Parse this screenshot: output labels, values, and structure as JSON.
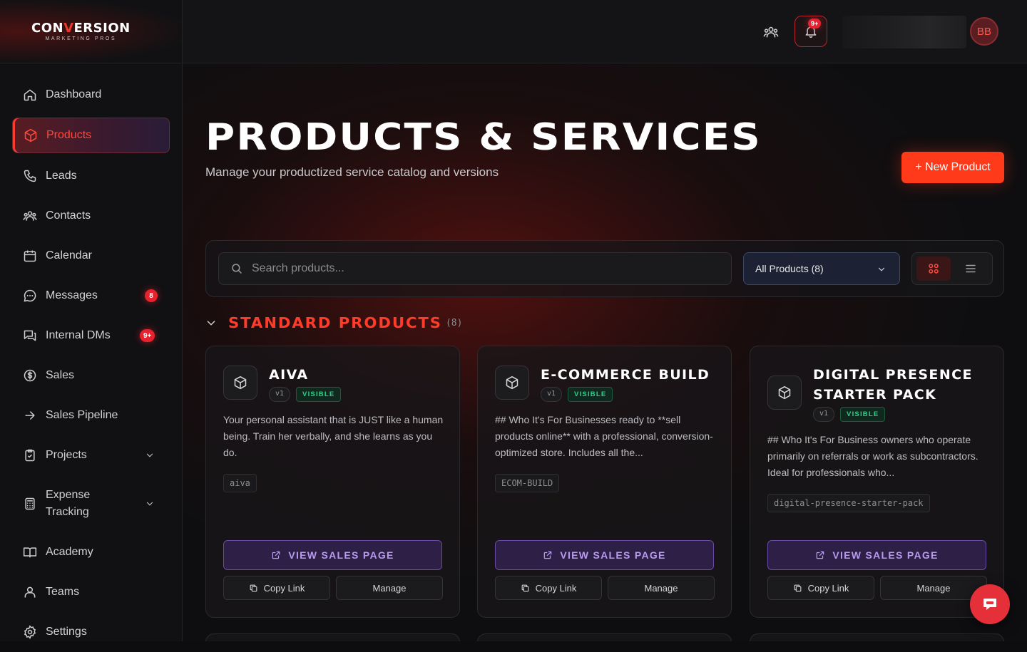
{
  "brand": {
    "logo_main_left": "CON",
    "logo_main_v": "V",
    "logo_main_right": "ERSION",
    "logo_sub": "MARKETING PROS"
  },
  "sidebar": {
    "items": [
      {
        "label": "Dashboard",
        "icon": "home-icon"
      },
      {
        "label": "Products",
        "icon": "package-icon",
        "active": true
      },
      {
        "label": "Leads",
        "icon": "phone-icon"
      },
      {
        "label": "Contacts",
        "icon": "users-icon"
      },
      {
        "label": "Calendar",
        "icon": "calendar-icon"
      },
      {
        "label": "Messages",
        "icon": "message-icon",
        "badge": "8"
      },
      {
        "label": "Internal DMs",
        "icon": "chat-bubbles-icon",
        "badge": "9+"
      },
      {
        "label": "Sales",
        "icon": "dollar-circle-icon"
      },
      {
        "label": "Sales Pipeline",
        "icon": "arrow-right-icon"
      },
      {
        "label": "Projects",
        "icon": "clipboard-icon",
        "expandable": true
      },
      {
        "label": "Expense Tracking",
        "icon": "calculator-icon",
        "expandable": true
      },
      {
        "label": "Academy",
        "icon": "book-icon"
      },
      {
        "label": "Teams",
        "icon": "team-icon"
      },
      {
        "label": "Settings",
        "icon": "gear-icon"
      }
    ]
  },
  "topbar": {
    "notification_badge": "9+",
    "avatar_initials": "BB"
  },
  "page": {
    "title": "PRODUCTS & SERVICES",
    "subtitle": "Manage your productized service catalog and versions",
    "new_button": "+ New Product"
  },
  "filters": {
    "search_placeholder": "Search products...",
    "select_value": "All Products (8)",
    "view_mode": "grid"
  },
  "section": {
    "title": "STANDARD PRODUCTS",
    "count": "(8)"
  },
  "products": [
    {
      "name": "AIVA",
      "version": "v1",
      "status": "VISIBLE",
      "description": "Your personal assistant that is JUST like a human being. Train her verbally, and she learns as you do.",
      "slug": "aiva"
    },
    {
      "name": "E-COMMERCE BUILD",
      "version": "v1",
      "status": "VISIBLE",
      "description": "## Who It's For Businesses ready to **sell products online** with a professional, conversion-optimized store. Includes all the...",
      "slug": "ECOM-BUILD"
    },
    {
      "name": "DIGITAL PRESENCE STARTER PACK",
      "version": "v1",
      "status": "VISIBLE",
      "description": "## Who It's For Business owners who operate primarily on referrals or work as subcontractors. Ideal for professionals who...",
      "slug": "digital-presence-starter-pack"
    }
  ],
  "card_actions": {
    "sales_page": "VIEW SALES PAGE",
    "copy_link": "Copy Link",
    "manage": "Manage"
  },
  "colors": {
    "accent": "#ff3a1a",
    "visible_green": "#2fd08a",
    "sales_purple": "#b89af0"
  }
}
